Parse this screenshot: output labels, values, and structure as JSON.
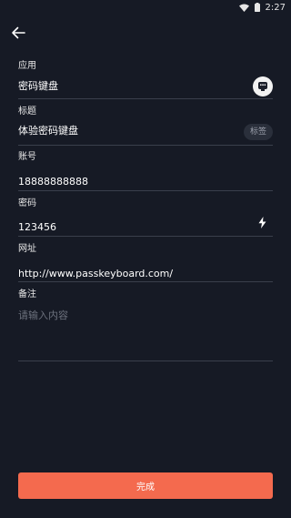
{
  "status_bar": {
    "time": "2:27",
    "icons": [
      "wifi-icon",
      "battery-icon"
    ]
  },
  "header": {
    "back_icon": "arrow-left-icon"
  },
  "form": {
    "app": {
      "label": "应用",
      "value": "密码键盘",
      "icon": "app-icon"
    },
    "title": {
      "label": "标题",
      "value": "体验密码键盘",
      "tag_button": "标签"
    },
    "account": {
      "label": "账号",
      "value": "18888888888"
    },
    "password": {
      "label": "密码",
      "value": "123456",
      "icon": "lightning-icon"
    },
    "url": {
      "label": "网址",
      "value": "http://www.passkeyboard.com/"
    },
    "notes": {
      "label": "备注",
      "placeholder": "请输入内容"
    }
  },
  "footer": {
    "done_label": "完成",
    "accent": "#f46a4e"
  },
  "colors": {
    "background": "#161a25",
    "divider": "#3a3f4c"
  }
}
